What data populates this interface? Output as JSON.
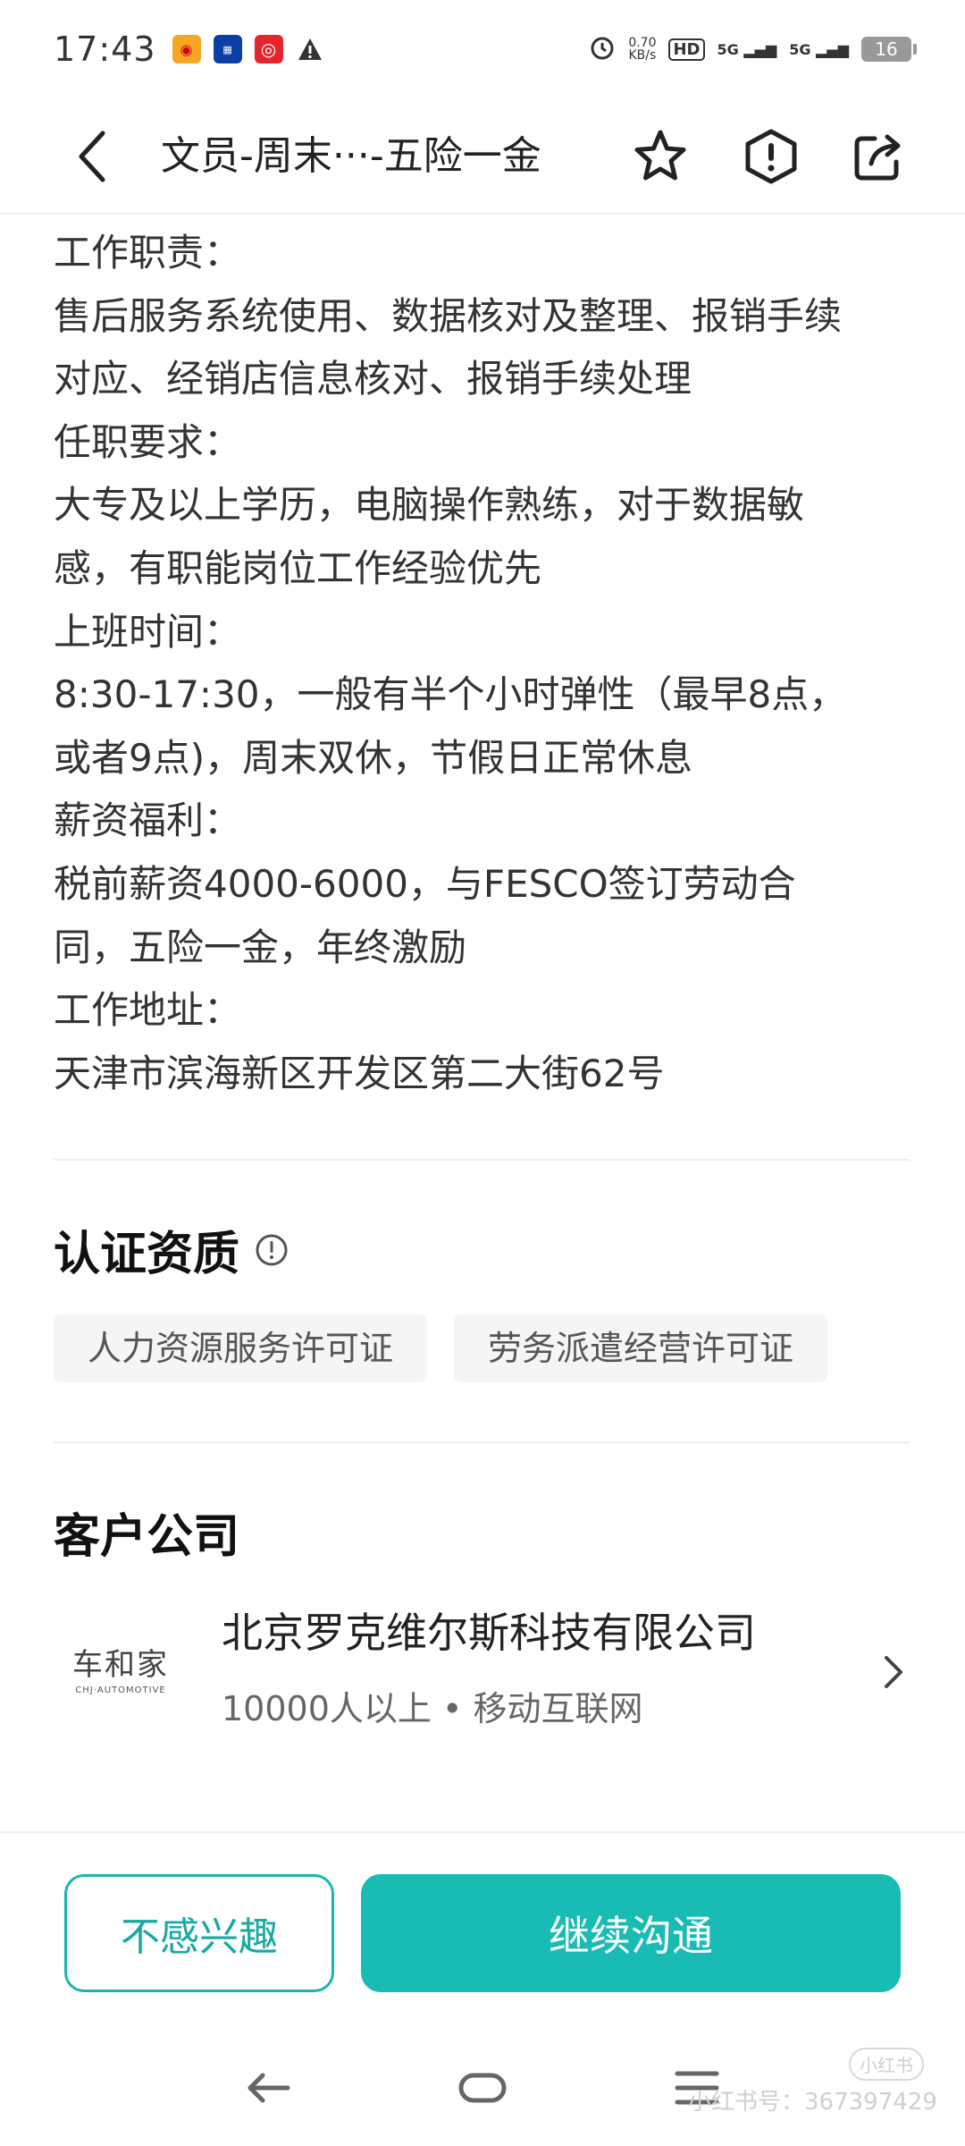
{
  "status_bar": {
    "time": "17:43",
    "net_speed_value": "0.70",
    "net_speed_unit": "KB/s",
    "hd": "HD",
    "sim1": "5G",
    "sim2": "5G",
    "battery": "16"
  },
  "header": {
    "title": "文员-周末···-五险一金"
  },
  "description": {
    "lines": [
      "工作职责：",
      "售后服务系统使用、数据核对及整理、报销手续",
      "对应、经销店信息核对、报销手续处理",
      "任职要求：",
      "大专及以上学历，电脑操作熟练，对于数据敏",
      "感，有职能岗位工作经验优先",
      "上班时间：",
      "8:30-17:30，一般有半个小时弹性（最早8点，",
      "或者9点)，周末双休，节假日正常休息",
      "薪资福利：",
      "税前薪资4000-6000，与FESCO签订劳动合",
      "同，五险一金，年终激励",
      "工作地址：",
      "天津市滨海新区开发区第二大街62号"
    ]
  },
  "certification": {
    "title": "认证资质",
    "tags": [
      "人力资源服务许可证",
      "劳务派遣经营许可证"
    ]
  },
  "client_company": {
    "title": "客户公司",
    "logo_cn": "车和家",
    "logo_en": "CHJ·AUTOMOTIVE",
    "name": "北京罗克维尔斯科技有限公司",
    "meta": "10000人以上 • 移动互联网"
  },
  "actions": {
    "not_interested": "不感兴趣",
    "continue": "继续沟通"
  },
  "watermark": {
    "logo": "小红书",
    "text": "小红书号：367397429"
  },
  "colors": {
    "accent": "#19bcb5",
    "accent_text": "#17a9a3"
  }
}
